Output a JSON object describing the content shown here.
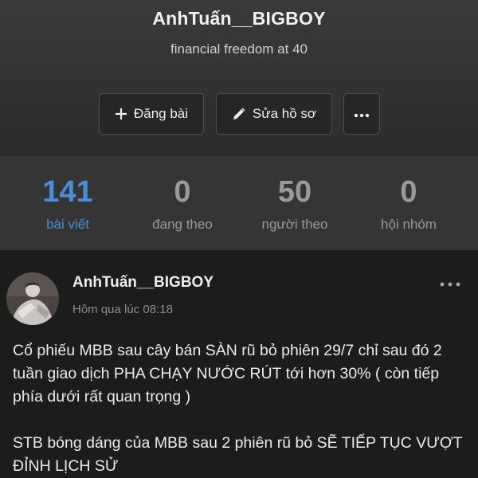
{
  "profile": {
    "username": "AnhTuấn__BIGBOY",
    "bio": "financial freedom at 40",
    "actions": {
      "post_label": "Đăng bài",
      "edit_label": "Sửa hồ sơ"
    }
  },
  "stats": [
    {
      "value": "141",
      "label": "bài viết",
      "active": true
    },
    {
      "value": "0",
      "label": "đang theo",
      "active": false
    },
    {
      "value": "50",
      "label": "người theo",
      "active": false
    },
    {
      "value": "0",
      "label": "hội nhóm",
      "active": false
    }
  ],
  "post": {
    "author": "AnhTuấn__BIGBOY",
    "timestamp": "Hôm qua lúc 08:18",
    "paragraphs": [
      "Cổ phiếu MBB sau cây bán SÀN rũ bỏ phiên 29/7 chỉ sau đó 2 tuần giao dịch PHA CHẠY NƯỚC RÚT tới hơn 30% ( còn tiếp phía dưới rất quan trọng )",
      "STB bóng dáng của MBB sau 2 phiên rũ bỏ SẼ TIẾP TỤC VƯỢT ĐỈNH LỊCH SỬ"
    ]
  },
  "colors": {
    "accent": "#4a8fd6",
    "header_bg": "#2c2c2c",
    "stats_bg": "#353535",
    "feed_bg": "#1c1c1c"
  },
  "icons": [
    "plus-icon",
    "pencil-icon",
    "more-horizontal-icon",
    "avatar-photo"
  ]
}
